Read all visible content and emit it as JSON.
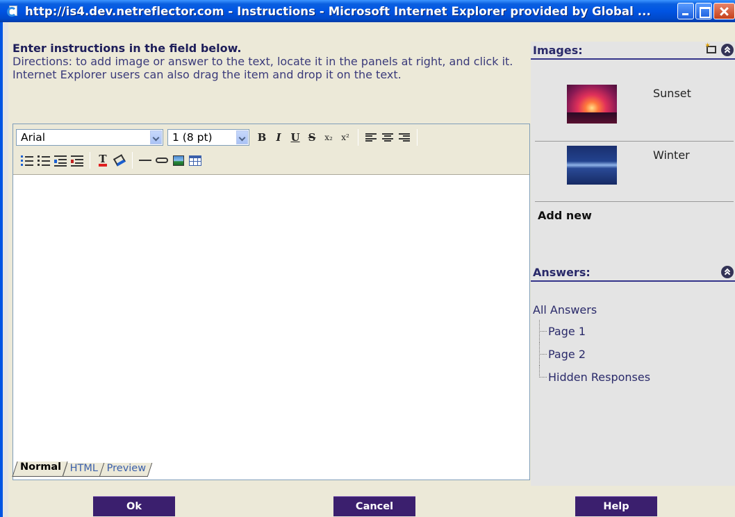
{
  "window": {
    "title": "http://is4.dev.netreflector.com - Instructions - Microsoft Internet Explorer provided by Global ..."
  },
  "instructions": {
    "heading": "Enter instructions in the field below.",
    "directions": "Directions: to add image or answer to the text, locate it in the panels at right, and click it. Internet Explorer users can also drag the item and drop it on the text."
  },
  "toolbar": {
    "font_name": "Arial",
    "font_size": "1 (8 pt)",
    "bold": "B",
    "italic": "I",
    "underline": "U",
    "strike": "S",
    "subscript": "x₂",
    "superscript": "x²"
  },
  "editor_tabs": [
    "Normal",
    "HTML",
    "Preview"
  ],
  "images_panel": {
    "title": "Images:",
    "items": [
      {
        "name": "Sunset"
      },
      {
        "name": "Winter"
      }
    ],
    "add_new": "Add new"
  },
  "answers_panel": {
    "title": "Answers:",
    "root": "All Answers",
    "items": [
      "Page 1",
      "Page 2",
      "Hidden Responses"
    ]
  },
  "buttons": {
    "ok": "Ok",
    "cancel": "Cancel",
    "help": "Help"
  }
}
